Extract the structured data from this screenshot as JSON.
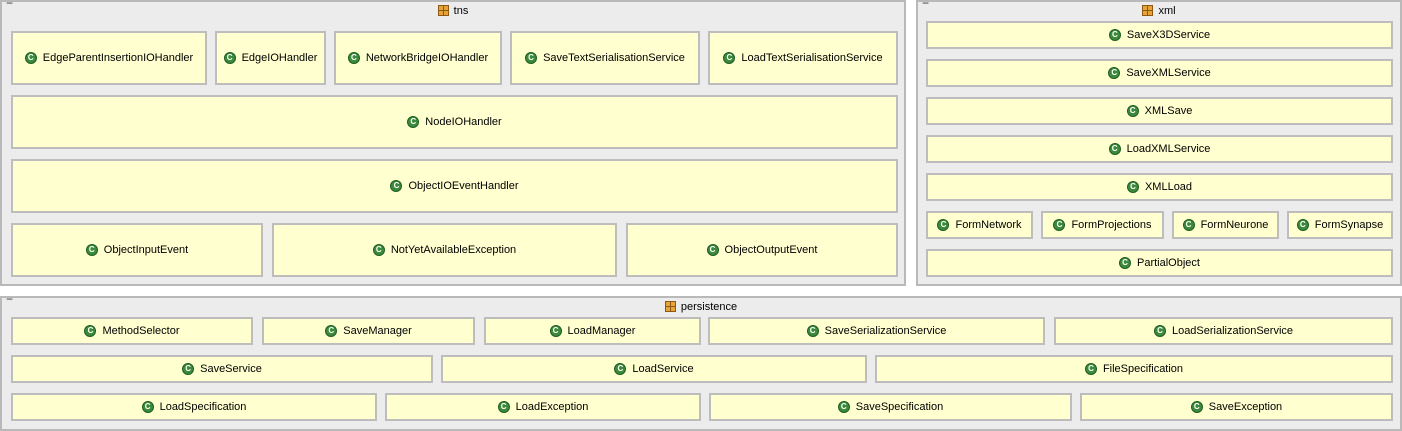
{
  "packages": {
    "tns": {
      "collapse": "−",
      "name": "tns",
      "classes": {
        "edge_parent": "EdgeParentInsertionIOHandler",
        "edge_io": "EdgeIOHandler",
        "network_bridge": "NetworkBridgeIOHandler",
        "save_text": "SaveTextSerialisationService",
        "load_text": "LoadTextSerialisationService",
        "node_io": "NodeIOHandler",
        "object_io_event": "ObjectIOEventHandler",
        "object_input": "ObjectInputEvent",
        "not_yet": "NotYetAvailableException",
        "object_output": "ObjectOutputEvent"
      }
    },
    "xml": {
      "collapse": "−",
      "name": "xml",
      "classes": {
        "save_x3d": "SaveX3DService",
        "save_xml": "SaveXMLService",
        "xml_save": "XMLSave",
        "load_xml": "LoadXMLService",
        "xml_load": "XMLLoad",
        "form_network": "FormNetwork",
        "form_projections": "FormProjections",
        "form_neurone": "FormNeurone",
        "form_synapse": "FormSynapse",
        "partial_object": "PartialObject"
      }
    },
    "persistence": {
      "collapse": "−",
      "name": "persistence",
      "classes": {
        "method_selector": "MethodSelector",
        "save_manager": "SaveManager",
        "load_manager": "LoadManager",
        "save_serialization": "SaveSerializationService",
        "load_serialization": "LoadSerializationService",
        "save_service": "SaveService",
        "load_service": "LoadService",
        "file_specification": "FileSpecification",
        "load_specification": "LoadSpecification",
        "load_exception": "LoadException",
        "save_specification": "SaveSpecification",
        "save_exception": "SaveException"
      }
    }
  },
  "class_icon_letter": "C",
  "colors": {
    "package_bg": "#ececec",
    "class_bg": "#ffffd0",
    "class_icon": "#3c8a3c",
    "package_icon": "#e8a33a"
  }
}
